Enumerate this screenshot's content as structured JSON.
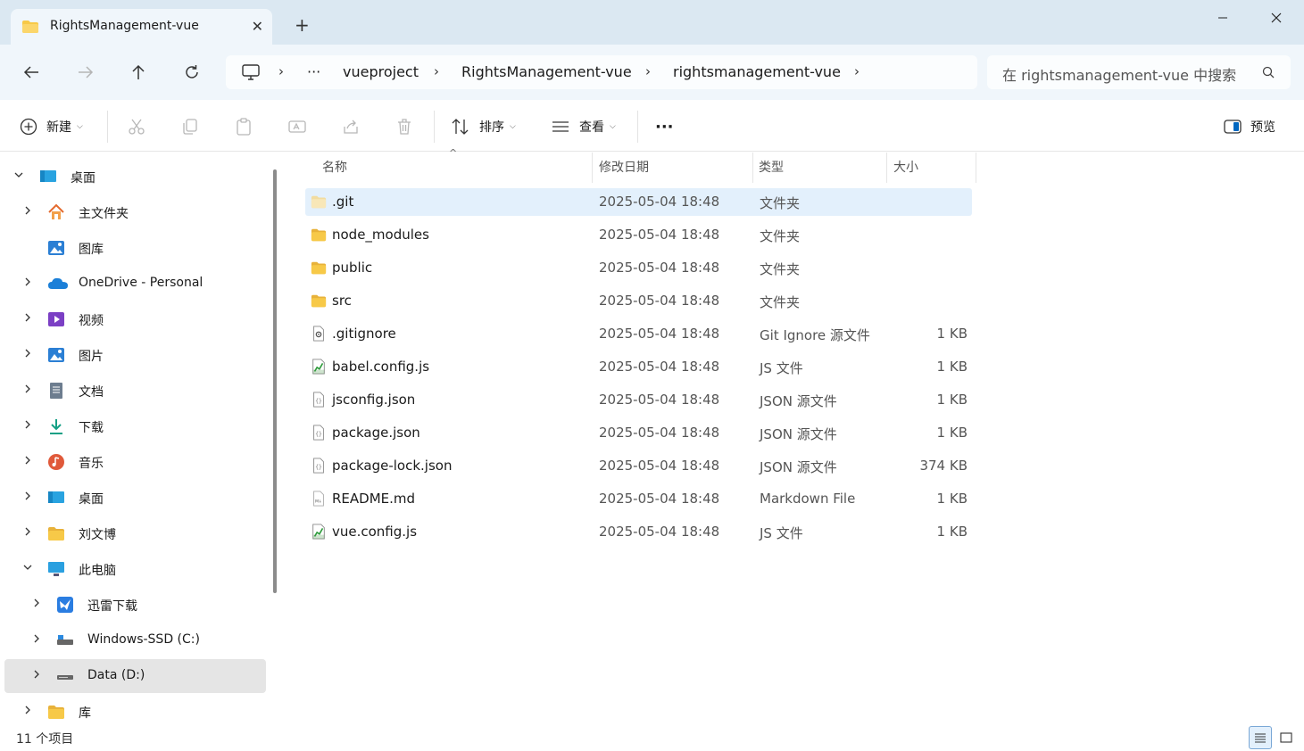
{
  "window": {
    "tab_title": "RightsManagement-vue",
    "tab_icon": "folder-icon",
    "close_tab": "✕",
    "new_tab": "+",
    "controls": {
      "minimize": "—",
      "maximize": "☐",
      "close": "✕"
    }
  },
  "nav": {
    "back": "←",
    "forward": "→",
    "up": "↑",
    "refresh": "⟳",
    "address": {
      "root_icon": "computer-icon",
      "overflow": "···",
      "segments": [
        "vueproject",
        "RightsManagement-vue",
        "rightsmanagement-vue"
      ],
      "chevron": "›"
    },
    "search_placeholder": "在 rightsmanagement-vue 中搜索"
  },
  "toolbar": {
    "new_label": "新建",
    "sort_label": "排序",
    "view_label": "查看",
    "more_label": "···",
    "preview_label": "预览"
  },
  "sidebar": {
    "items": [
      {
        "label": "桌面",
        "icon": "desktop-icon",
        "expander": "⌄",
        "expanded": true
      },
      {
        "label": "主文件夹",
        "icon": "home-icon",
        "expander": "›"
      },
      {
        "label": "图库",
        "icon": "gallery-icon",
        "expander": ""
      },
      {
        "label": "OneDrive - Personal",
        "icon": "onedrive-icon",
        "expander": "›"
      },
      {
        "label": "视频",
        "icon": "videos-icon",
        "expander": "›"
      },
      {
        "label": "图片",
        "icon": "pictures-icon",
        "expander": "›"
      },
      {
        "label": "文档",
        "icon": "documents-icon",
        "expander": "›"
      },
      {
        "label": "下载",
        "icon": "downloads-icon",
        "expander": "›"
      },
      {
        "label": "音乐",
        "icon": "music-icon",
        "expander": "›"
      },
      {
        "label": "桌面",
        "icon": "desktop-icon",
        "expander": "›"
      },
      {
        "label": "刘文博",
        "icon": "folder-icon",
        "expander": "›"
      },
      {
        "label": "此电脑",
        "icon": "this-pc-icon",
        "expander": "⌄",
        "expanded": true
      },
      {
        "label": "迅雷下载",
        "icon": "xunlei-icon",
        "expander": "›"
      },
      {
        "label": "Windows-SSD (C:)",
        "icon": "drive-c-icon",
        "expander": "›"
      },
      {
        "label": "Data (D:)",
        "icon": "drive-icon",
        "expander": "›",
        "selected": true
      },
      {
        "label": "库",
        "icon": "folder-icon",
        "expander": "›"
      }
    ]
  },
  "columns": {
    "name": "名称",
    "date": "修改日期",
    "type": "类型",
    "size": "大小",
    "sort_arrow": "^"
  },
  "files": [
    {
      "name": ".git",
      "date": "2025-05-04 18:48",
      "type": "文件夹",
      "size": "",
      "icon": "folder-light-icon",
      "selected": true
    },
    {
      "name": "node_modules",
      "date": "2025-05-04 18:48",
      "type": "文件夹",
      "size": "",
      "icon": "folder-icon"
    },
    {
      "name": "public",
      "date": "2025-05-04 18:48",
      "type": "文件夹",
      "size": "",
      "icon": "folder-icon"
    },
    {
      "name": "src",
      "date": "2025-05-04 18:48",
      "type": "文件夹",
      "size": "",
      "icon": "folder-icon"
    },
    {
      "name": ".gitignore",
      "date": "2025-05-04 18:48",
      "type": "Git Ignore 源文件",
      "size": "1 KB",
      "icon": "settings-file-icon"
    },
    {
      "name": "babel.config.js",
      "date": "2025-05-04 18:48",
      "type": "JS 文件",
      "size": "1 KB",
      "icon": "js-file-icon"
    },
    {
      "name": "jsconfig.json",
      "date": "2025-05-04 18:48",
      "type": "JSON 源文件",
      "size": "1 KB",
      "icon": "json-file-icon"
    },
    {
      "name": "package.json",
      "date": "2025-05-04 18:48",
      "type": "JSON 源文件",
      "size": "1 KB",
      "icon": "json-file-icon"
    },
    {
      "name": "package-lock.json",
      "date": "2025-05-04 18:48",
      "type": "JSON 源文件",
      "size": "374 KB",
      "icon": "json-file-icon"
    },
    {
      "name": "README.md",
      "date": "2025-05-04 18:48",
      "type": "Markdown File",
      "size": "1 KB",
      "icon": "markdown-file-icon"
    },
    {
      "name": "vue.config.js",
      "date": "2025-05-04 18:48",
      "type": "JS 文件",
      "size": "1 KB",
      "icon": "js-file-icon"
    }
  ],
  "status": {
    "count": "11 个项目"
  },
  "colors": {
    "titlebar": "#dbe8f2",
    "navbar": "#f0f6fb",
    "selection": "#e3f0fc",
    "folder": "#f7c948",
    "accent": "#0067c0"
  }
}
